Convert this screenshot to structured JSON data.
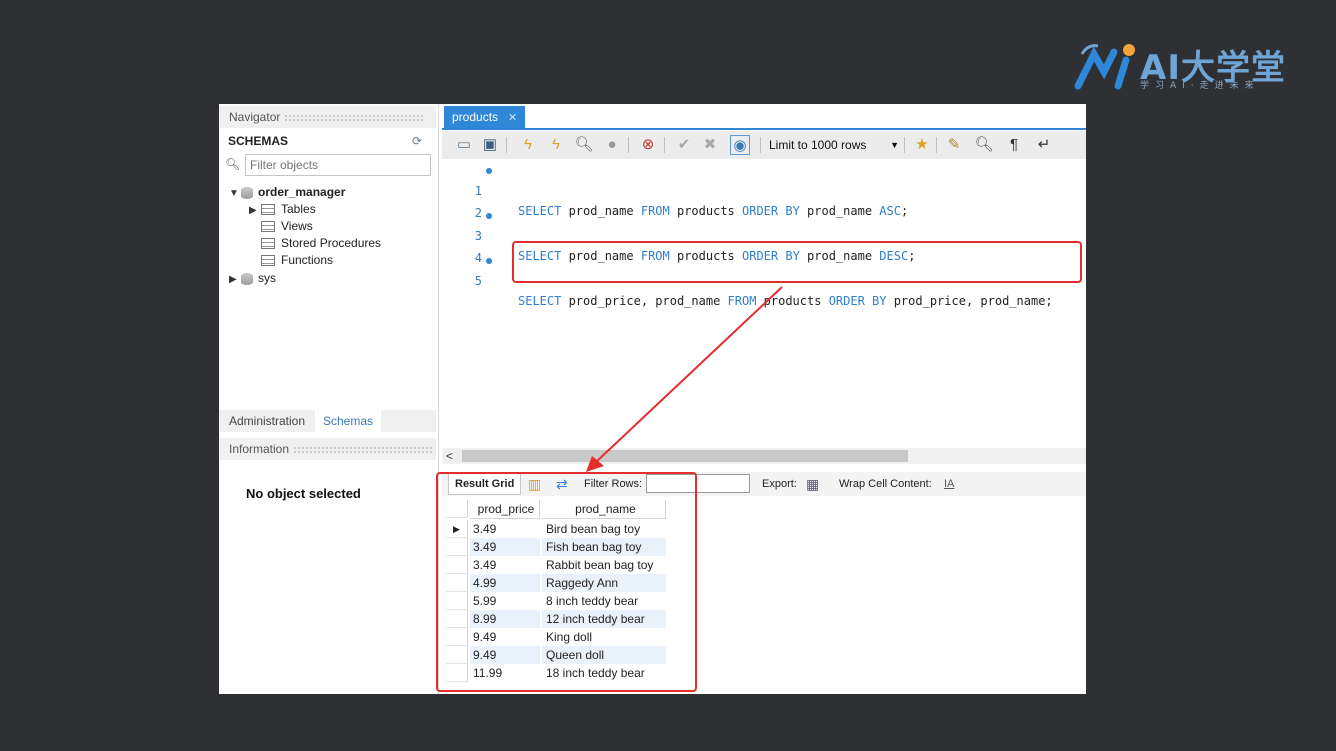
{
  "brand": {
    "title": "AI大学堂",
    "subtitle": "学习AI·走进未来"
  },
  "navigator": {
    "header": "Navigator",
    "schemas_label": "SCHEMAS",
    "filter_placeholder": "Filter objects",
    "tree": [
      {
        "label": "order_manager",
        "bold": true
      },
      {
        "label": "Tables"
      },
      {
        "label": "Views"
      },
      {
        "label": "Stored Procedures"
      },
      {
        "label": "Functions"
      },
      {
        "label": "sys"
      }
    ],
    "tabs": {
      "administration": "Administration",
      "schemas": "Schemas"
    },
    "info_header": "Information",
    "no_object": "No object selected"
  },
  "editor": {
    "tab_title": "products",
    "limit_label": "Limit to 1000 rows",
    "lines": [
      {
        "n": "1",
        "dot": true
      },
      {
        "n": "2",
        "dot": false
      },
      {
        "n": "3",
        "dot": true
      },
      {
        "n": "4",
        "dot": false
      },
      {
        "n": "5",
        "dot": true
      }
    ],
    "sql": {
      "l1": {
        "k1": "SELECT",
        "a": " prod_name ",
        "k2": "FROM",
        "b": " products ",
        "k3": "ORDER BY",
        "c": " prod_name ",
        "k4": "ASC",
        "d": ";"
      },
      "l3": {
        "k1": "SELECT",
        "a": " prod_name ",
        "k2": "FROM",
        "b": " products ",
        "k3": "ORDER BY",
        "c": " prod_name ",
        "k4": "DESC",
        "d": ";"
      },
      "l5": {
        "k1": "SELECT",
        "a": " prod_price, prod_name ",
        "k2": "FROM",
        "b": " products ",
        "k3": "ORDER BY",
        "c": " prod_price, prod_name;"
      }
    }
  },
  "result": {
    "result_grid": "Result Grid",
    "filter_rows": "Filter Rows:",
    "export": "Export:",
    "wrap": "Wrap Cell Content:",
    "columns": [
      "prod_price",
      "prod_name"
    ],
    "rows": [
      [
        "3.49",
        "Bird bean bag toy"
      ],
      [
        "3.49",
        "Fish bean bag toy"
      ],
      [
        "3.49",
        "Rabbit bean bag toy"
      ],
      [
        "4.99",
        "Raggedy Ann"
      ],
      [
        "5.99",
        "8 inch teddy bear"
      ],
      [
        "8.99",
        "12 inch teddy bear"
      ],
      [
        "9.49",
        "King doll"
      ],
      [
        "9.49",
        "Queen doll"
      ],
      [
        "11.99",
        "18 inch teddy bear"
      ]
    ]
  },
  "colors": {
    "accent": "#2f87d8",
    "keyword": "#2f7fcf",
    "highlight": "#e62d2d"
  }
}
